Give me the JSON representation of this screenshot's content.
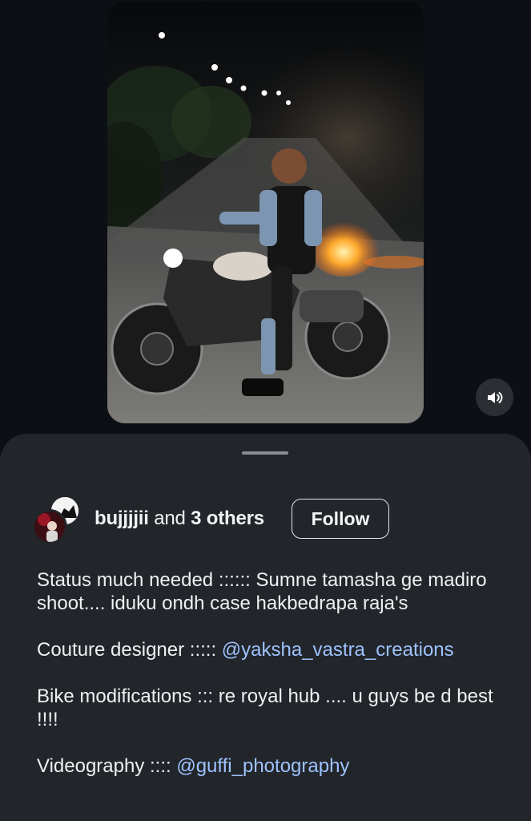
{
  "reel": {
    "video_alt": "Man seated on a custom motorcycle at night with fire in background"
  },
  "controls": {
    "sound_icon": "speaker-volume-icon"
  },
  "post": {
    "owner_primary": "bujjjjii",
    "owner_join": "and",
    "owner_others": "3 others",
    "follow_label": "Follow",
    "caption": {
      "line1_text": "Status much needed :::::: Sumne tamasha ge madiro shoot.... iduku ondh case hakbedrapa raja's",
      "line2_text": "Couture designer ::::: ",
      "line2_mention": "@yaksha_vastra_creations",
      "line3_text": "Bike modifications ::: re royal hub .... u guys be d best !!!!",
      "line4_text": "Videography :::: ",
      "line4_mention": "@guffi_photography"
    }
  },
  "colors": {
    "background": "#0c0f14",
    "sheet": "#22252a",
    "mention": "#9ec3ff"
  }
}
